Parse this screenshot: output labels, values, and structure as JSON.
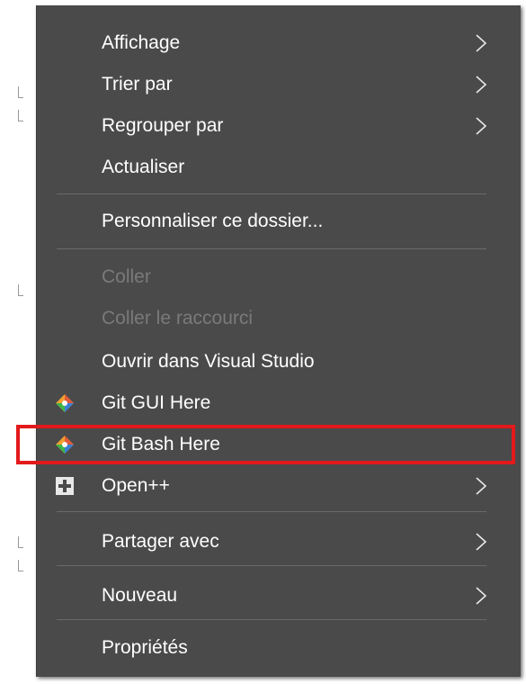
{
  "menu": {
    "items": [
      {
        "label": "Affichage",
        "submenu": true,
        "enabled": true
      },
      {
        "label": "Trier par",
        "submenu": true,
        "enabled": true
      },
      {
        "label": "Regrouper par",
        "submenu": true,
        "enabled": true
      },
      {
        "label": "Actualiser",
        "submenu": false,
        "enabled": true
      },
      {
        "label": "Personnaliser ce dossier...",
        "submenu": false,
        "enabled": true
      },
      {
        "label": "Coller",
        "submenu": false,
        "enabled": false
      },
      {
        "label": "Coller le raccourci",
        "submenu": false,
        "enabled": false
      },
      {
        "label": "Ouvrir dans Visual Studio",
        "submenu": false,
        "enabled": true
      },
      {
        "label": "Git GUI Here",
        "submenu": false,
        "enabled": true,
        "icon": "git-icon"
      },
      {
        "label": "Git Bash Here",
        "submenu": false,
        "enabled": true,
        "icon": "git-icon",
        "highlighted": true
      },
      {
        "label": "Open++",
        "submenu": true,
        "enabled": true,
        "icon": "plus-box-icon"
      },
      {
        "label": "Partager avec",
        "submenu": true,
        "enabled": true
      },
      {
        "label": "Nouveau",
        "submenu": true,
        "enabled": true
      },
      {
        "label": "Propriétés",
        "submenu": false,
        "enabled": true
      }
    ]
  },
  "colors": {
    "menu_background": "#4a4a4a",
    "text": "#ffffff",
    "disabled_text": "#7a7a7a",
    "highlight_border": "#e3191b"
  }
}
